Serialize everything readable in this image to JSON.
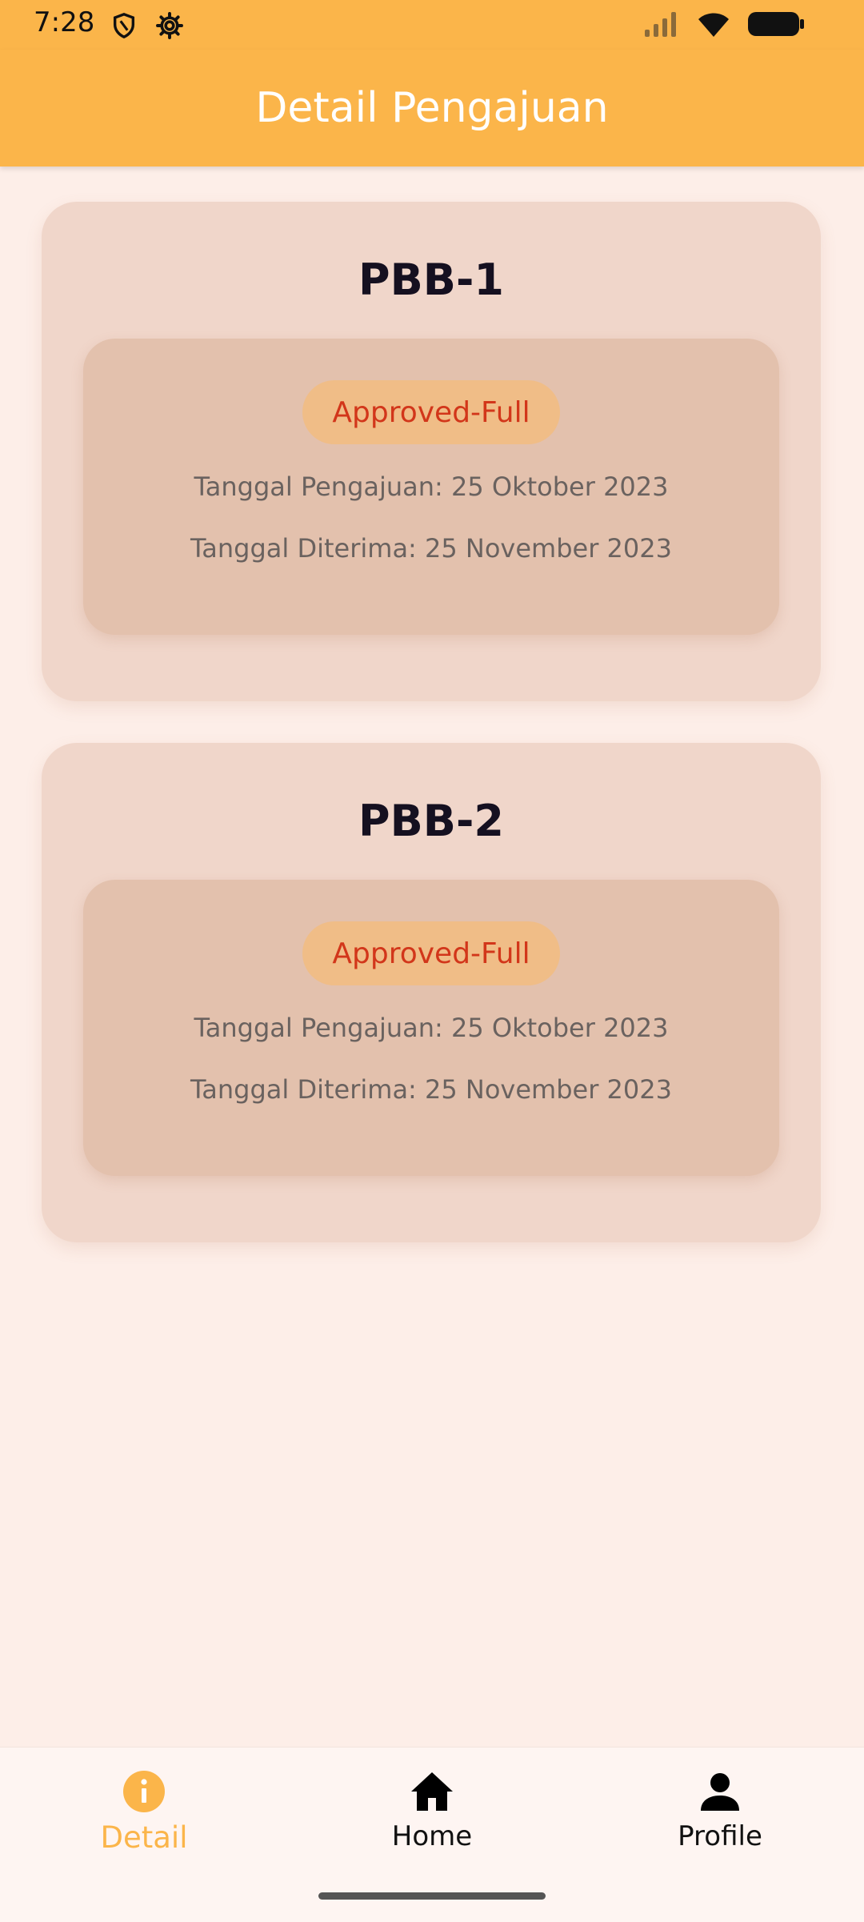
{
  "status_bar": {
    "time": "7:28",
    "icons": [
      "shield-icon",
      "gear-icon",
      "signal-icon",
      "wifi-icon",
      "battery-icon"
    ]
  },
  "header": {
    "title": "Detail Pengajuan"
  },
  "cards": [
    {
      "title": "PBB-1",
      "status": "Approved-Full",
      "tanggal_pengajuan": "Tanggal Pengajuan: 25 Oktober 2023",
      "tanggal_diterima": "Tanggal Diterima: 25 November 2023"
    },
    {
      "title": "PBB-2",
      "status": "Approved-Full",
      "tanggal_pengajuan": "Tanggal Pengajuan: 25 Oktober 2023",
      "tanggal_diterima": "Tanggal Diterima: 25 November 2023"
    }
  ],
  "bottom_nav": {
    "items": [
      {
        "label": "Detail",
        "icon": "info-icon",
        "active": true
      },
      {
        "label": "Home",
        "icon": "home-icon",
        "active": false
      },
      {
        "label": "Profile",
        "icon": "person-icon",
        "active": false
      }
    ]
  },
  "colors": {
    "accent": "#fbb54a",
    "background": "#fdeee8",
    "card": "#f0d6ca",
    "inner_card": "#e3c1ad",
    "badge": "#f0bd87",
    "badge_text": "#d2361a"
  }
}
